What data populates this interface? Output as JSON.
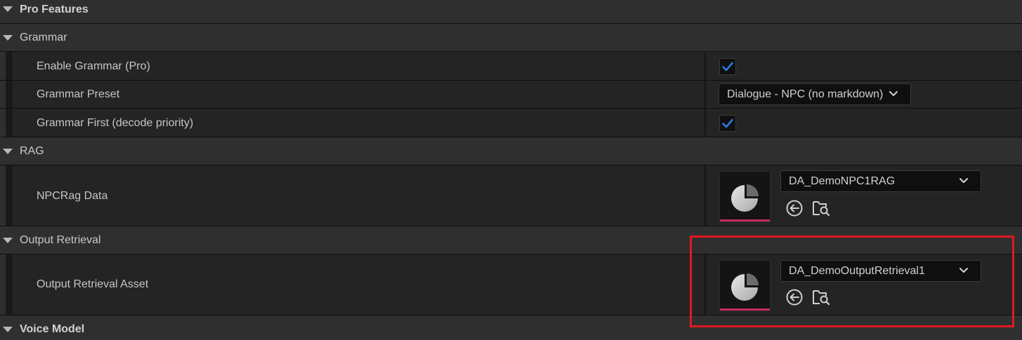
{
  "sections": {
    "pro_features": {
      "label": "Pro Features"
    },
    "grammar": {
      "label": "Grammar"
    },
    "rag": {
      "label": "RAG"
    },
    "output_retrieval": {
      "label": "Output Retrieval"
    },
    "voice_model": {
      "label": "Voice Model"
    }
  },
  "properties": {
    "enable_grammar": {
      "label": "Enable Grammar (Pro)",
      "checked": true
    },
    "grammar_preset": {
      "label": "Grammar Preset",
      "value": "Dialogue - NPC (no markdown)"
    },
    "grammar_first": {
      "label": "Grammar First (decode priority)",
      "checked": true
    },
    "npc_rag_data": {
      "label": "NPCRag Data",
      "asset": "DA_DemoNPC1RAG"
    },
    "output_retrieval_asset": {
      "label": "Output Retrieval Asset",
      "asset": "DA_DemoOutputRetrieval1"
    }
  },
  "icons": {
    "expand": "triangle-down-icon",
    "check": "checkmark-icon",
    "thumbnail": "data-asset-pie-icon",
    "use_selected": "arrow-left-circle-icon",
    "browse": "folder-search-icon",
    "dropdown": "chevron-down-icon"
  },
  "colors": {
    "check": "#2a7be4",
    "asset_bar": "#c8295b",
    "highlight": "#e0191e"
  }
}
